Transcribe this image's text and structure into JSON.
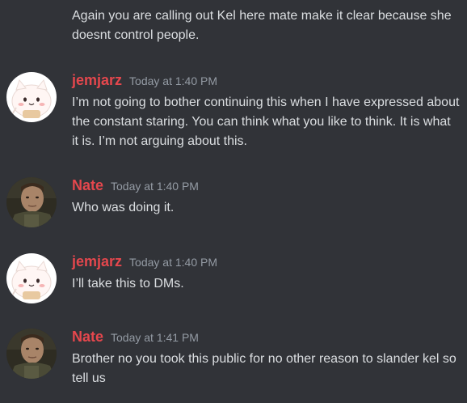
{
  "continuation": {
    "text": "Again you are calling out Kel here mate make it clear because she doesnt control people."
  },
  "messages": [
    {
      "author": "jemjarz",
      "timestamp": "Today at 1:40 PM",
      "avatar": "cat-avatar-icon",
      "text": "I’m not going to bother continuing this when I have expressed about the constant staring. You can think what you like to think. It is what it is. I’m not arguing about this."
    },
    {
      "author": "Nate",
      "timestamp": "Today at 1:40 PM",
      "avatar": "soldier-avatar-icon",
      "text": "Who was doing it."
    },
    {
      "author": "jemjarz",
      "timestamp": "Today at 1:40 PM",
      "avatar": "cat-avatar-icon",
      "text": "I’ll take this to DMs."
    },
    {
      "author": "Nate",
      "timestamp": "Today at 1:41 PM",
      "avatar": "soldier-avatar-icon",
      "text": "Brother no you took this public for no other reason to slander kel so tell us"
    }
  ],
  "colors": {
    "background": "#313338",
    "username": "#e5474d",
    "timestamp": "#949ba4",
    "text": "#dbdee1"
  }
}
